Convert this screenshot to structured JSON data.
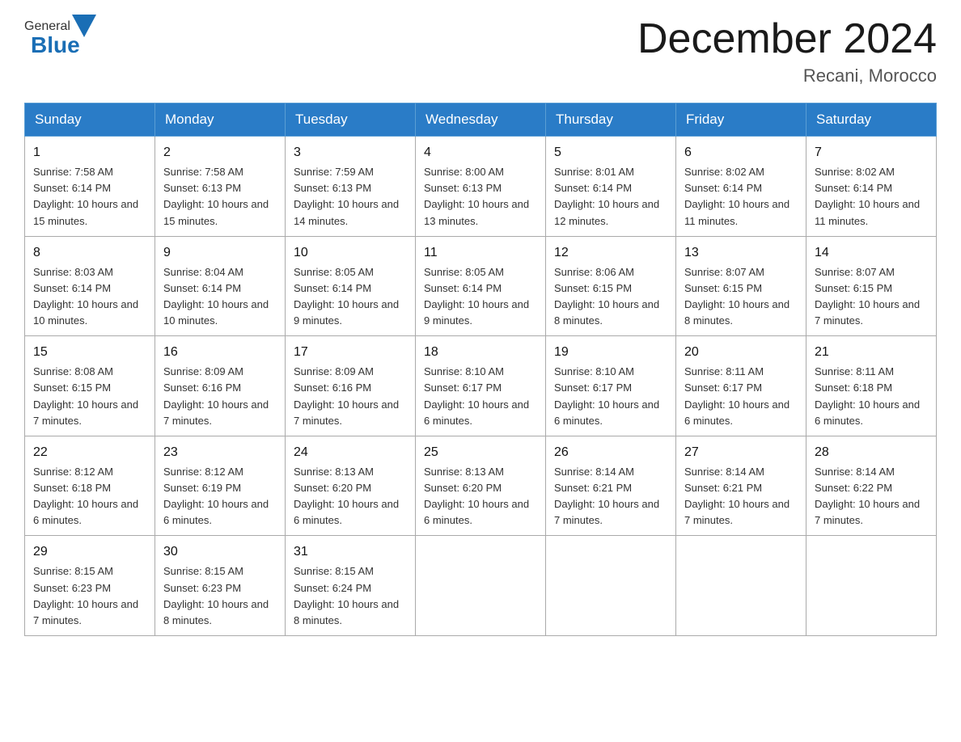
{
  "logo": {
    "general": "General",
    "blue": "Blue"
  },
  "title": "December 2024",
  "location": "Recani, Morocco",
  "days_of_week": [
    "Sunday",
    "Monday",
    "Tuesday",
    "Wednesday",
    "Thursday",
    "Friday",
    "Saturday"
  ],
  "weeks": [
    [
      {
        "day": "1",
        "sunrise": "7:58 AM",
        "sunset": "6:14 PM",
        "daylight": "10 hours and 15 minutes."
      },
      {
        "day": "2",
        "sunrise": "7:58 AM",
        "sunset": "6:13 PM",
        "daylight": "10 hours and 15 minutes."
      },
      {
        "day": "3",
        "sunrise": "7:59 AM",
        "sunset": "6:13 PM",
        "daylight": "10 hours and 14 minutes."
      },
      {
        "day": "4",
        "sunrise": "8:00 AM",
        "sunset": "6:13 PM",
        "daylight": "10 hours and 13 minutes."
      },
      {
        "day": "5",
        "sunrise": "8:01 AM",
        "sunset": "6:14 PM",
        "daylight": "10 hours and 12 minutes."
      },
      {
        "day": "6",
        "sunrise": "8:02 AM",
        "sunset": "6:14 PM",
        "daylight": "10 hours and 11 minutes."
      },
      {
        "day": "7",
        "sunrise": "8:02 AM",
        "sunset": "6:14 PM",
        "daylight": "10 hours and 11 minutes."
      }
    ],
    [
      {
        "day": "8",
        "sunrise": "8:03 AM",
        "sunset": "6:14 PM",
        "daylight": "10 hours and 10 minutes."
      },
      {
        "day": "9",
        "sunrise": "8:04 AM",
        "sunset": "6:14 PM",
        "daylight": "10 hours and 10 minutes."
      },
      {
        "day": "10",
        "sunrise": "8:05 AM",
        "sunset": "6:14 PM",
        "daylight": "10 hours and 9 minutes."
      },
      {
        "day": "11",
        "sunrise": "8:05 AM",
        "sunset": "6:14 PM",
        "daylight": "10 hours and 9 minutes."
      },
      {
        "day": "12",
        "sunrise": "8:06 AM",
        "sunset": "6:15 PM",
        "daylight": "10 hours and 8 minutes."
      },
      {
        "day": "13",
        "sunrise": "8:07 AM",
        "sunset": "6:15 PM",
        "daylight": "10 hours and 8 minutes."
      },
      {
        "day": "14",
        "sunrise": "8:07 AM",
        "sunset": "6:15 PM",
        "daylight": "10 hours and 7 minutes."
      }
    ],
    [
      {
        "day": "15",
        "sunrise": "8:08 AM",
        "sunset": "6:15 PM",
        "daylight": "10 hours and 7 minutes."
      },
      {
        "day": "16",
        "sunrise": "8:09 AM",
        "sunset": "6:16 PM",
        "daylight": "10 hours and 7 minutes."
      },
      {
        "day": "17",
        "sunrise": "8:09 AM",
        "sunset": "6:16 PM",
        "daylight": "10 hours and 7 minutes."
      },
      {
        "day": "18",
        "sunrise": "8:10 AM",
        "sunset": "6:17 PM",
        "daylight": "10 hours and 6 minutes."
      },
      {
        "day": "19",
        "sunrise": "8:10 AM",
        "sunset": "6:17 PM",
        "daylight": "10 hours and 6 minutes."
      },
      {
        "day": "20",
        "sunrise": "8:11 AM",
        "sunset": "6:17 PM",
        "daylight": "10 hours and 6 minutes."
      },
      {
        "day": "21",
        "sunrise": "8:11 AM",
        "sunset": "6:18 PM",
        "daylight": "10 hours and 6 minutes."
      }
    ],
    [
      {
        "day": "22",
        "sunrise": "8:12 AM",
        "sunset": "6:18 PM",
        "daylight": "10 hours and 6 minutes."
      },
      {
        "day": "23",
        "sunrise": "8:12 AM",
        "sunset": "6:19 PM",
        "daylight": "10 hours and 6 minutes."
      },
      {
        "day": "24",
        "sunrise": "8:13 AM",
        "sunset": "6:20 PM",
        "daylight": "10 hours and 6 minutes."
      },
      {
        "day": "25",
        "sunrise": "8:13 AM",
        "sunset": "6:20 PM",
        "daylight": "10 hours and 6 minutes."
      },
      {
        "day": "26",
        "sunrise": "8:14 AM",
        "sunset": "6:21 PM",
        "daylight": "10 hours and 7 minutes."
      },
      {
        "day": "27",
        "sunrise": "8:14 AM",
        "sunset": "6:21 PM",
        "daylight": "10 hours and 7 minutes."
      },
      {
        "day": "28",
        "sunrise": "8:14 AM",
        "sunset": "6:22 PM",
        "daylight": "10 hours and 7 minutes."
      }
    ],
    [
      {
        "day": "29",
        "sunrise": "8:15 AM",
        "sunset": "6:23 PM",
        "daylight": "10 hours and 7 minutes."
      },
      {
        "day": "30",
        "sunrise": "8:15 AM",
        "sunset": "6:23 PM",
        "daylight": "10 hours and 8 minutes."
      },
      {
        "day": "31",
        "sunrise": "8:15 AM",
        "sunset": "6:24 PM",
        "daylight": "10 hours and 8 minutes."
      },
      null,
      null,
      null,
      null
    ]
  ],
  "labels": {
    "sunrise_prefix": "Sunrise: ",
    "sunset_prefix": "Sunset: ",
    "daylight_prefix": "Daylight: "
  }
}
